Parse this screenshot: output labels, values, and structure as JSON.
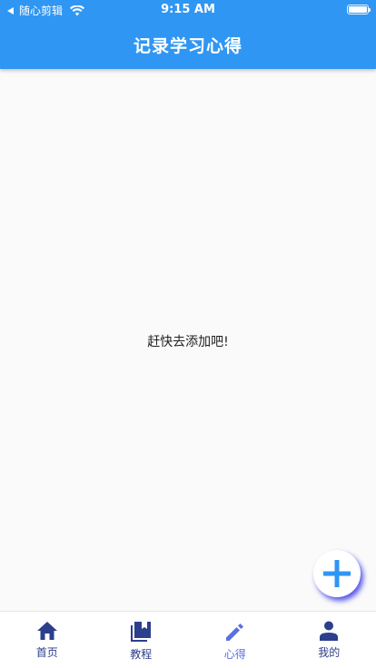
{
  "status_bar": {
    "carrier": "随心剪辑",
    "time": "9:15 AM"
  },
  "header": {
    "title": "记录学习心得"
  },
  "main": {
    "empty_message": "赶快去添加吧!"
  },
  "fab": {
    "icon": "plus-icon"
  },
  "bottom_nav": {
    "items": [
      {
        "label": "首页",
        "icon": "home-icon",
        "active": false
      },
      {
        "label": "教程",
        "icon": "library-icon",
        "active": false
      },
      {
        "label": "心得",
        "icon": "pencil-icon",
        "active": true
      },
      {
        "label": "我的",
        "icon": "person-icon",
        "active": false
      }
    ]
  },
  "colors": {
    "primary": "#2f96f3",
    "nav_inactive": "#2b3f8c",
    "nav_active": "#5a6fe0"
  }
}
